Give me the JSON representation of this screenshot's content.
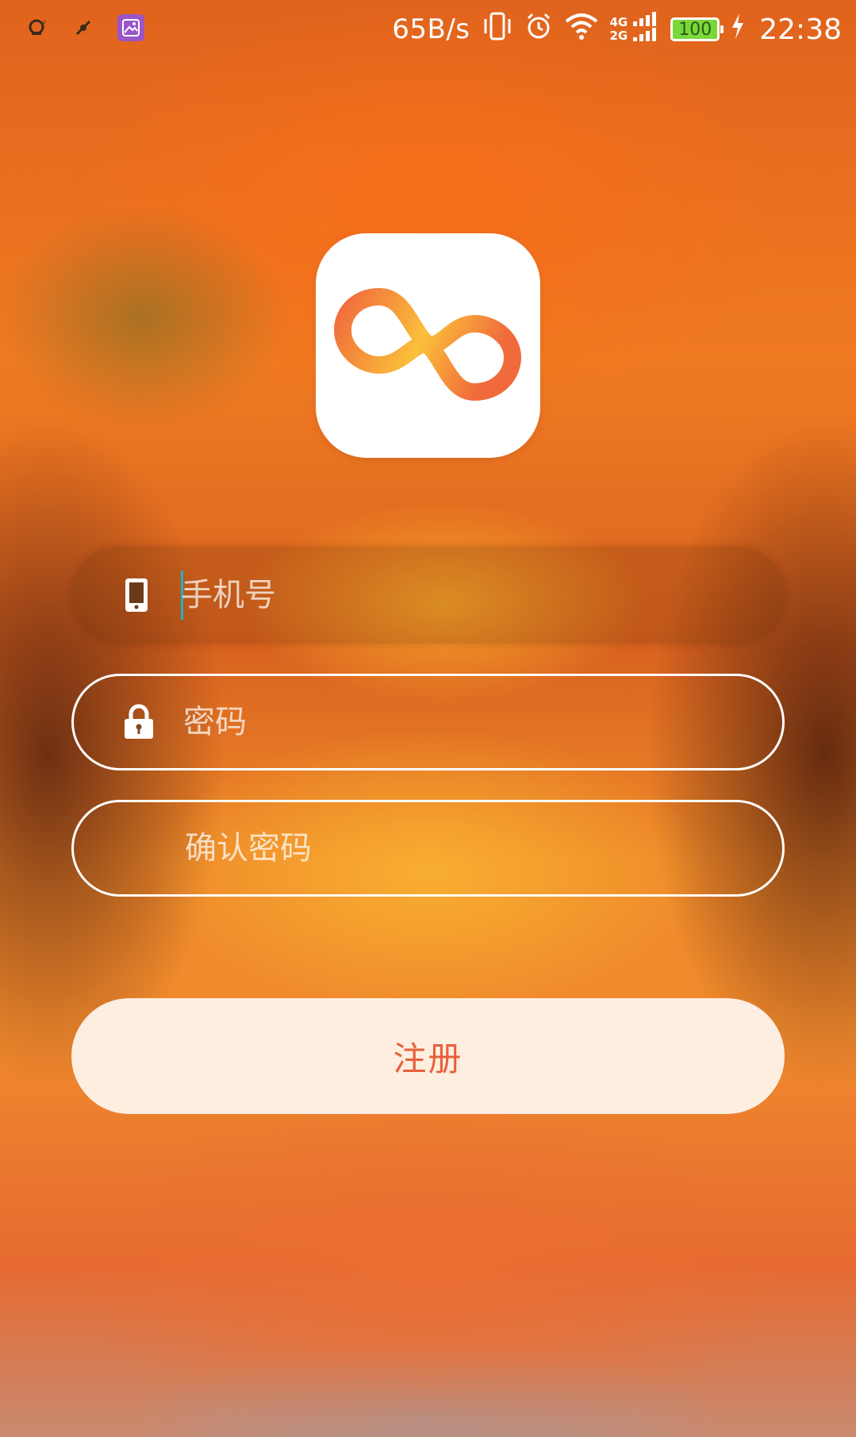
{
  "status_bar": {
    "net_speed": "65B/s",
    "network_top": "4G",
    "network_bottom": "2G",
    "battery": "100",
    "time": "22:38"
  },
  "form": {
    "phone_placeholder": "手机号",
    "password_placeholder": "密码",
    "confirm_placeholder": "确认密码"
  },
  "register_label": "注册",
  "colors": {
    "accent": "#e8603a",
    "caret": "#19b4c8",
    "logo_gradient_start": "#f06a3c",
    "logo_gradient_end": "#fbbf3a"
  },
  "icons": {
    "phone_field": "phone-icon",
    "password_field": "lock-icon",
    "logo": "infinity-logo-icon"
  }
}
